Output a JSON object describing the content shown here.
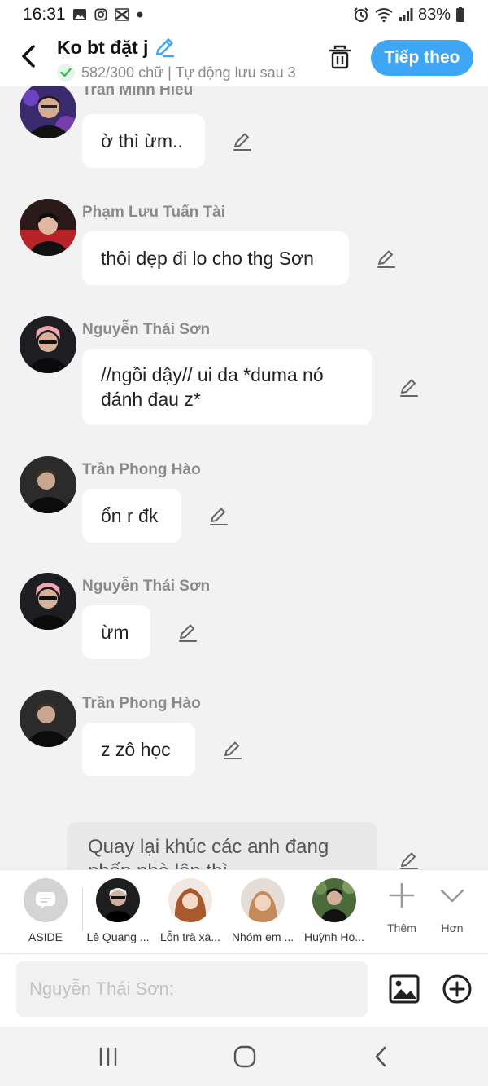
{
  "status_bar": {
    "time": "16:31",
    "battery": "83%",
    "left_icons": [
      "image-icon",
      "instagram-icon",
      "capcut-icon",
      "dot-icon"
    ],
    "right_icons": [
      "alarm-icon",
      "wifi-icon",
      "signal-icon",
      "battery-icon"
    ]
  },
  "header": {
    "title": "Ko bt đặt j",
    "subtitle": "582/300 chữ | Tự động lưu sau 3",
    "next_label": "Tiếp theo",
    "accent_color": "#3ea6f5"
  },
  "messages": [
    {
      "sender": "Trần Minh Hiếu",
      "text": "ờ thì ừm.."
    },
    {
      "sender": "Phạm Lưu Tuấn Tài",
      "text": "thôi dẹp đi lo cho thg Sơn"
    },
    {
      "sender": "Nguyễn Thái Sơn",
      "text": "//ngồi dậy// ui da *duma nó đánh đau z*"
    },
    {
      "sender": "Trần Phong Hào",
      "text": "ổn r đk"
    },
    {
      "sender": "Nguyễn Thái Sơn",
      "text": "ừm"
    },
    {
      "sender": "Trần Phong Hào",
      "text": "z zô học"
    }
  ],
  "aside_message": {
    "text": "Quay lại khúc các anh đang phấn nhà lên thì..."
  },
  "characters": [
    {
      "label": "ASIDE"
    },
    {
      "label": "Lê Quang ..."
    },
    {
      "label": "Lỗn trà xa..."
    },
    {
      "label": "Nhóm em ..."
    },
    {
      "label": "Huỳnh Ho..."
    }
  ],
  "actions": {
    "more_label": "Thêm",
    "expand_label": "Hơn"
  },
  "input": {
    "placeholder": "Nguyễn Thái Sơn:"
  }
}
